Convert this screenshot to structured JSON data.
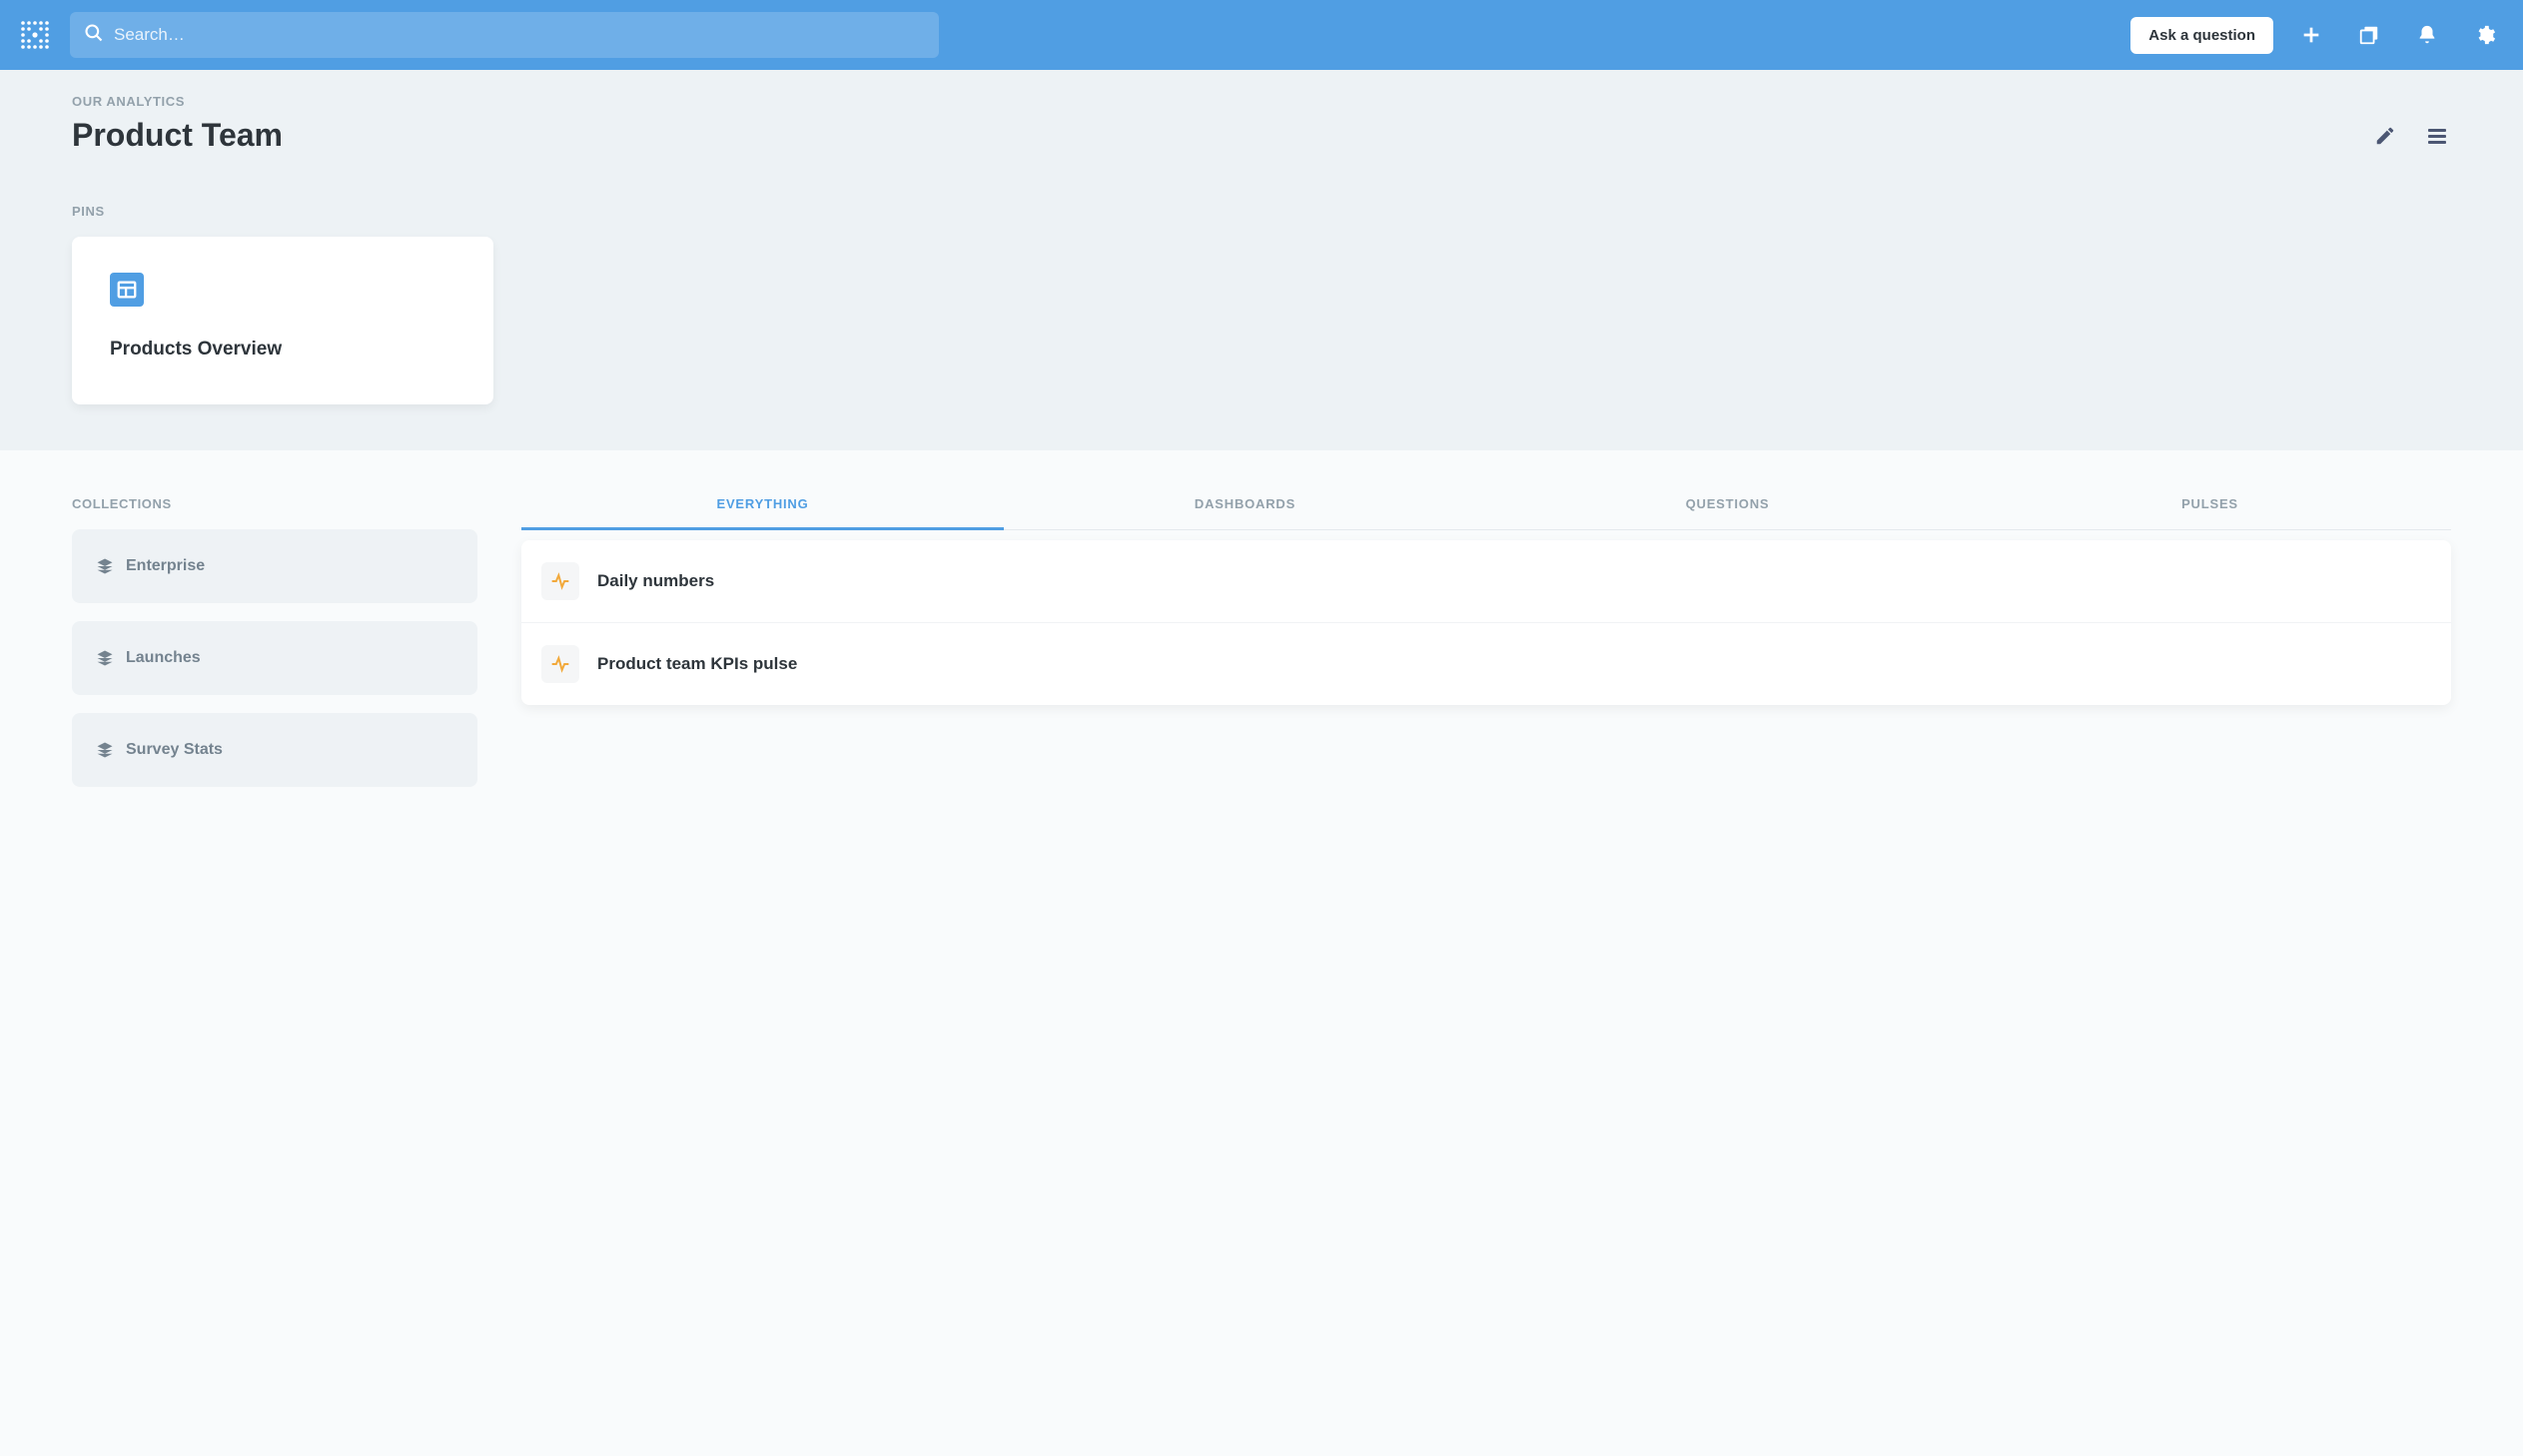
{
  "header": {
    "search_placeholder": "Search…",
    "ask_label": "Ask a question"
  },
  "breadcrumb": "OUR ANALYTICS",
  "page_title": "Product Team",
  "pins_label": "PINS",
  "pins": [
    {
      "title": "Products Overview"
    }
  ],
  "collections_label": "COLLECTIONS",
  "collections": [
    {
      "name": "Enterprise"
    },
    {
      "name": "Launches"
    },
    {
      "name": "Survey Stats"
    }
  ],
  "tabs": [
    {
      "label": "EVERYTHING",
      "active": true
    },
    {
      "label": "DASHBOARDS",
      "active": false
    },
    {
      "label": "QUESTIONS",
      "active": false
    },
    {
      "label": "PULSES",
      "active": false
    }
  ],
  "items": [
    {
      "title": "Daily numbers"
    },
    {
      "title": "Product team KPIs pulse"
    }
  ]
}
